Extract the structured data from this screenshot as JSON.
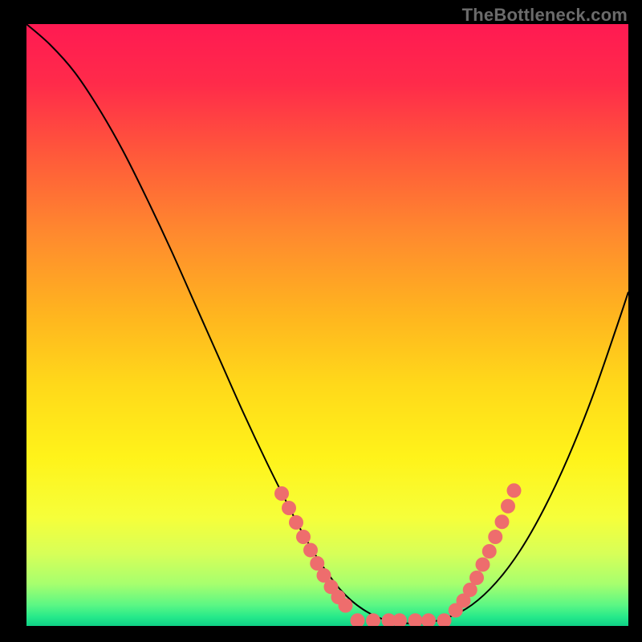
{
  "watermark": "TheBottleneck.com",
  "gradient_stops": [
    {
      "offset": 0.0,
      "color": "#ff1a52"
    },
    {
      "offset": 0.1,
      "color": "#ff2b4a"
    },
    {
      "offset": 0.22,
      "color": "#ff5a3a"
    },
    {
      "offset": 0.35,
      "color": "#ff8a2e"
    },
    {
      "offset": 0.48,
      "color": "#ffb41f"
    },
    {
      "offset": 0.6,
      "color": "#ffd91a"
    },
    {
      "offset": 0.72,
      "color": "#fff31a"
    },
    {
      "offset": 0.82,
      "color": "#f6ff3a"
    },
    {
      "offset": 0.88,
      "color": "#d7ff58"
    },
    {
      "offset": 0.93,
      "color": "#a7ff6e"
    },
    {
      "offset": 0.965,
      "color": "#5cf784"
    },
    {
      "offset": 0.985,
      "color": "#26e98a"
    },
    {
      "offset": 1.0,
      "color": "#0fd186"
    }
  ],
  "chart_data": {
    "type": "line",
    "title": "",
    "xlabel": "",
    "ylabel": "",
    "xlim": [
      0,
      100
    ],
    "ylim": [
      0,
      100
    ],
    "grid": false,
    "legend": false,
    "series": [
      {
        "name": "bottleneck-curve",
        "stroke": "#000000",
        "stroke_width": 2,
        "x": [
          0,
          4,
          8,
          12,
          16,
          20,
          24,
          28,
          32,
          36,
          40,
          44,
          46,
          48,
          50,
          52,
          54,
          56,
          58,
          60,
          62,
          66,
          70,
          74,
          78,
          82,
          86,
          90,
          94,
          98,
          100
        ],
        "y": [
          100,
          96.5,
          92,
          86,
          79,
          71,
          62.5,
          53.5,
          44.5,
          35.5,
          27,
          19,
          15.2,
          11.8,
          8.8,
          6.2,
          4.2,
          2.7,
          1.6,
          0.9,
          0.5,
          0.5,
          1.4,
          3.5,
          7.2,
          12.5,
          19.5,
          28,
          38,
          49.5,
          55.5
        ]
      }
    ],
    "markers": [
      {
        "name": "left-branch-dots",
        "shape": "circle",
        "fill": "#ee6d6d",
        "radius": 9,
        "points": [
          {
            "x": 42.4,
            "y": 22.0
          },
          {
            "x": 43.6,
            "y": 19.6
          },
          {
            "x": 44.8,
            "y": 17.2
          },
          {
            "x": 46.0,
            "y": 14.8
          },
          {
            "x": 47.2,
            "y": 12.6
          },
          {
            "x": 48.3,
            "y": 10.4
          },
          {
            "x": 49.4,
            "y": 8.4
          },
          {
            "x": 50.6,
            "y": 6.5
          },
          {
            "x": 51.8,
            "y": 4.8
          },
          {
            "x": 53.0,
            "y": 3.4
          }
        ]
      },
      {
        "name": "bottom-flat-dots",
        "shape": "circle",
        "fill": "#ee6d6d",
        "radius": 9,
        "points": [
          {
            "x": 55.0,
            "y": 0.9
          },
          {
            "x": 57.6,
            "y": 0.9
          },
          {
            "x": 60.2,
            "y": 0.9
          },
          {
            "x": 62.0,
            "y": 0.9
          },
          {
            "x": 64.6,
            "y": 0.9
          },
          {
            "x": 66.8,
            "y": 0.9
          },
          {
            "x": 69.4,
            "y": 0.9
          }
        ]
      },
      {
        "name": "right-branch-dots",
        "shape": "circle",
        "fill": "#ee6d6d",
        "radius": 9,
        "points": [
          {
            "x": 71.3,
            "y": 2.6
          },
          {
            "x": 72.6,
            "y": 4.2
          },
          {
            "x": 73.7,
            "y": 6.0
          },
          {
            "x": 74.8,
            "y": 8.0
          },
          {
            "x": 75.8,
            "y": 10.2
          },
          {
            "x": 76.9,
            "y": 12.4
          },
          {
            "x": 77.9,
            "y": 14.8
          },
          {
            "x": 79.0,
            "y": 17.3
          },
          {
            "x": 80.0,
            "y": 19.9
          },
          {
            "x": 81.0,
            "y": 22.5
          }
        ]
      }
    ]
  }
}
